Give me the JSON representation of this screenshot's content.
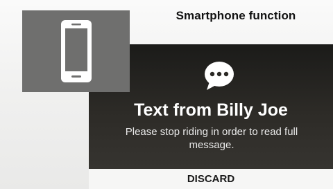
{
  "header": {
    "title": "Smartphone function"
  },
  "phone_tile": {
    "icon": "smartphone-icon",
    "background": "#6f6f6e"
  },
  "notification": {
    "icon": "chat-bubble-icon",
    "title": "Text from Billy Joe",
    "body": "Please stop riding in order to read full message.",
    "background": "#2d2b27"
  },
  "actions": {
    "discard_label": "DISCARD"
  }
}
